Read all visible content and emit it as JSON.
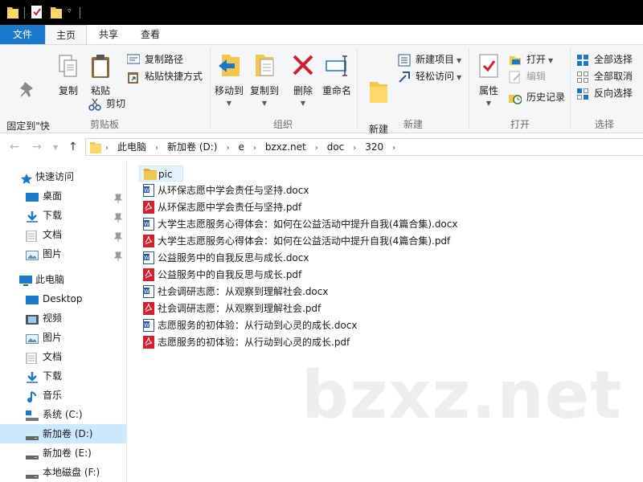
{
  "ribbon_tabs": {
    "file": "文件",
    "home": "主页",
    "share": "共享",
    "view": "查看"
  },
  "ribbon": {
    "clipboard": {
      "group_label": "剪贴板",
      "pin_quick_access": "固定到\"快\n速访问\"",
      "copy": "复制",
      "paste": "粘贴",
      "copy_path": "复制路径",
      "paste_shortcut": "粘贴快捷方式",
      "cut": "剪切"
    },
    "organize": {
      "group_label": "组织",
      "move_to": "移动到",
      "copy_to": "复制到",
      "delete": "删除",
      "rename": "重命名"
    },
    "new": {
      "group_label": "新建",
      "new_folder": "新建\n文件夹",
      "new_item": "新建项目",
      "easy_access": "轻松访问"
    },
    "open": {
      "group_label": "打开",
      "properties": "属性",
      "open": "打开",
      "edit": "编辑",
      "history": "历史记录"
    },
    "select": {
      "group_label": "选择",
      "select_all": "全部选择",
      "select_none": "全部取消",
      "invert": "反向选择"
    }
  },
  "breadcrumb": [
    "此电脑",
    "新加卷 (D:)",
    "e",
    "bzxz.net",
    "doc",
    "320"
  ],
  "nav_pane": {
    "quick_access": "快速访问",
    "quick_items": [
      "桌面",
      "下载",
      "文档",
      "图片"
    ],
    "this_pc": "此电脑",
    "pc_items": [
      "Desktop",
      "视频",
      "图片",
      "文档",
      "下载",
      "音乐",
      "系统 (C:)",
      "新加卷 (D:)",
      "新加卷 (E:)",
      "本地磁盘 (F:)"
    ]
  },
  "files": [
    {
      "name": "pic",
      "type": "folder"
    },
    {
      "name": "从环保志愿中学会责任与坚持.docx",
      "type": "docx"
    },
    {
      "name": "从环保志愿中学会责任与坚持.pdf",
      "type": "pdf"
    },
    {
      "name": "大学生志愿服务心得体会：如何在公益活动中提升自我(4篇合集).docx",
      "type": "docx"
    },
    {
      "name": "大学生志愿服务心得体会：如何在公益活动中提升自我(4篇合集).pdf",
      "type": "pdf"
    },
    {
      "name": "公益服务中的自我反思与成长.docx",
      "type": "docx"
    },
    {
      "name": "公益服务中的自我反思与成长.pdf",
      "type": "pdf"
    },
    {
      "name": "社会调研志愿：从观察到理解社会.docx",
      "type": "docx"
    },
    {
      "name": "社会调研志愿：从观察到理解社会.pdf",
      "type": "pdf"
    },
    {
      "name": "志愿服务的初体验：从行动到心灵的成长.docx",
      "type": "docx"
    },
    {
      "name": "志愿服务的初体验：从行动到心灵的成长.pdf",
      "type": "pdf"
    }
  ],
  "watermark": "bzxz.net",
  "colors": {
    "accent": "#1979ca",
    "selection": "#cce8ff",
    "folder": "#f3c64f",
    "pdf": "#d2202f",
    "word": "#2b579a"
  }
}
